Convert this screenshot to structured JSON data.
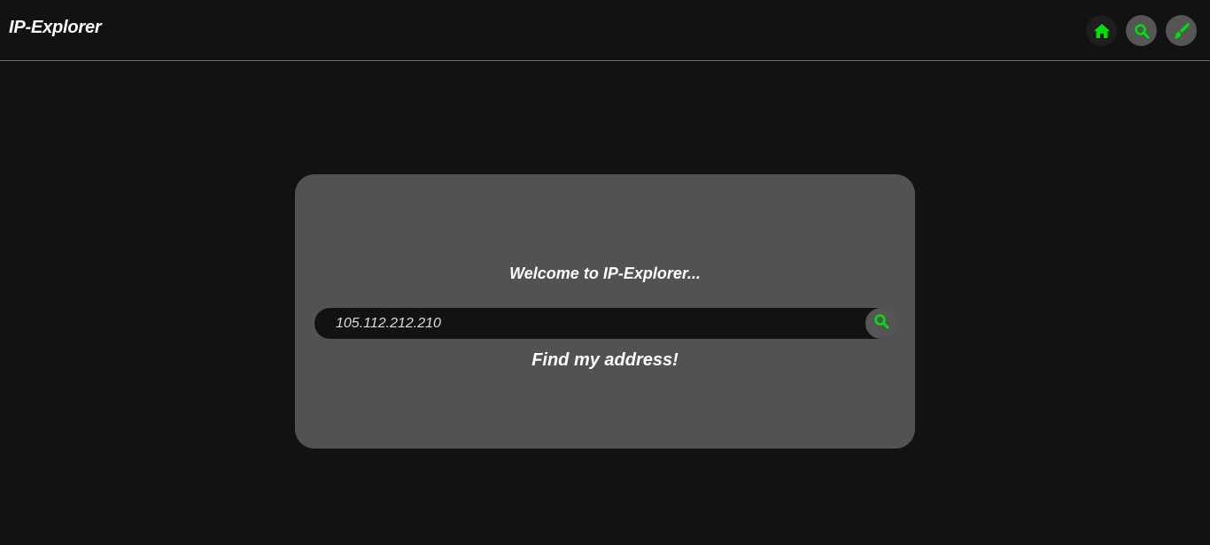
{
  "header": {
    "brand": "IP-Explorer",
    "nav": [
      {
        "icon": "home-icon"
      },
      {
        "icon": "search-icon"
      },
      {
        "icon": "brush-icon"
      }
    ]
  },
  "card": {
    "welcome": "Welcome to IP-Explorer...",
    "search": {
      "value": "105.112.212.210",
      "button_icon": "search-icon"
    },
    "find_link": "Find my address!"
  },
  "colors": {
    "background": "#121212",
    "card": "#525252",
    "accent": "#00e00b",
    "divider": "#6a6a6a"
  }
}
